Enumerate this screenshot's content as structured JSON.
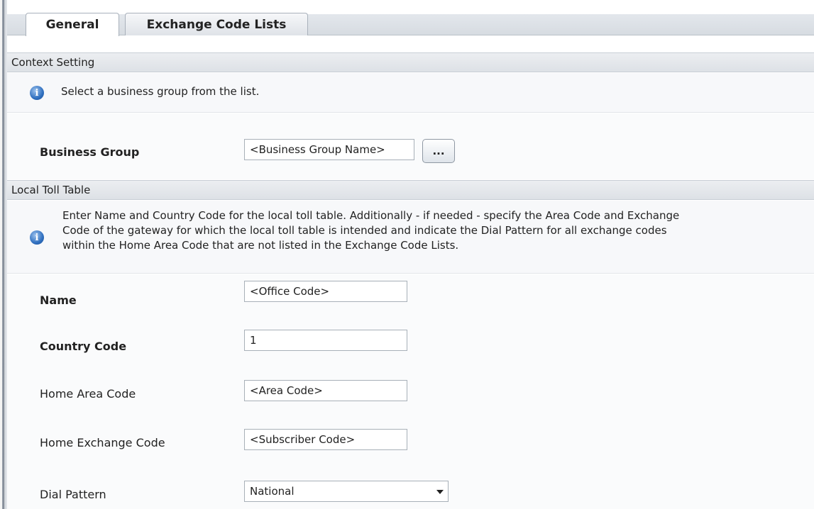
{
  "tabs": [
    {
      "label": "General",
      "active": true
    },
    {
      "label": "Exchange Code Lists",
      "active": false
    }
  ],
  "context_setting": {
    "header": "Context Setting",
    "info": "Select a business group from the list.",
    "business_group": {
      "label": "Business Group",
      "value": "<Business Group Name>",
      "browse_label": "..."
    }
  },
  "local_toll_table": {
    "header": "Local Toll Table",
    "info_lines": [
      "Enter Name and Country Code for the local toll table. Additionally - if needed - specify the Area Code and Exchange",
      "Code of the gateway for which the local toll table is intended and indicate the Dial Pattern for all exchange codes",
      "within the Home Area Code that are not listed in the Exchange Code Lists."
    ],
    "fields": {
      "name": {
        "label": "Name",
        "value": "<Office Code>"
      },
      "country_code": {
        "label": "Country Code",
        "value": "1"
      },
      "home_area_code": {
        "label": "Home Area Code",
        "value": "<Area Code>"
      },
      "home_exchange_code": {
        "label": "Home Exchange Code",
        "value": "<Subscriber Code>"
      },
      "dial_pattern": {
        "label": "Dial Pattern",
        "value": "National"
      }
    }
  },
  "icons": {
    "info": "info-icon",
    "dropdown": "chevron-down-icon"
  },
  "colors": {
    "info_icon": "#2f6fbf",
    "section_header_bg": "#e4e7eb",
    "tab_strip_bg": "#d6dbe1"
  }
}
